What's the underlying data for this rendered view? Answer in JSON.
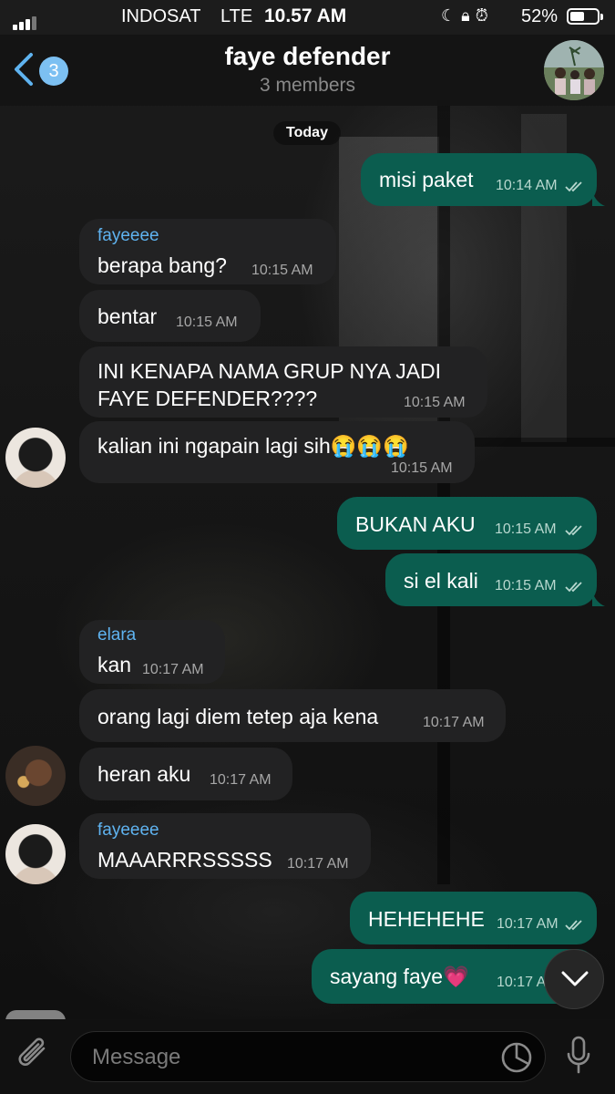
{
  "status_bar": {
    "carrier": "INDOSAT",
    "network": "LTE",
    "time": "10.57 AM",
    "battery_percent": "52%",
    "battery_level": 0.52,
    "icons": [
      "signal-icon",
      "alarm-clock-icon",
      "rotation-lock-icon",
      "dnd-icon"
    ]
  },
  "header": {
    "back_badge": "3",
    "title": "faye defender",
    "subtitle": "3 members"
  },
  "date_divider": "Today",
  "messages": [
    {
      "dir": "out",
      "text": "misi paket",
      "time": "10:14 AM"
    },
    {
      "dir": "in",
      "sender": "fayeeee",
      "text": "berapa bang?",
      "time": "10:15 AM"
    },
    {
      "dir": "in",
      "text": "bentar",
      "time": "10:15 AM"
    },
    {
      "dir": "in",
      "text": "INI KENAPA NAMA GRUP NYA JADI",
      "text2": "FAYE DEFENDER????",
      "time": "10:15 AM"
    },
    {
      "dir": "in",
      "text": "kalian ini ngapain lagi sih😭😭😭",
      "time": "10:15 AM"
    },
    {
      "dir": "out",
      "text": "BUKAN AKU",
      "time": "10:15 AM"
    },
    {
      "dir": "out",
      "text": "si el kali",
      "time": "10:15 AM"
    },
    {
      "dir": "in",
      "sender": "elara",
      "text": "kan",
      "time": "10:17 AM"
    },
    {
      "dir": "in",
      "text": "orang lagi diem tetep aja kena",
      "time": "10:17 AM"
    },
    {
      "dir": "in",
      "text": "heran aku",
      "time": "10:17 AM"
    },
    {
      "dir": "in",
      "sender": "fayeeee",
      "text": "MAAARRRSSSSS",
      "time": "10:17 AM"
    },
    {
      "dir": "out",
      "text": "HEHEHEHE",
      "time": "10:17 AM"
    },
    {
      "dir": "out",
      "text": "sayang faye💗",
      "time": "10:17 A"
    }
  ],
  "input": {
    "placeholder": "Message"
  },
  "colors": {
    "outgoing_bubble": "#0b5d4f",
    "incoming_bubble": "#222223",
    "sender_name": "#5fb3f0",
    "accent": "#7cc0f2"
  }
}
